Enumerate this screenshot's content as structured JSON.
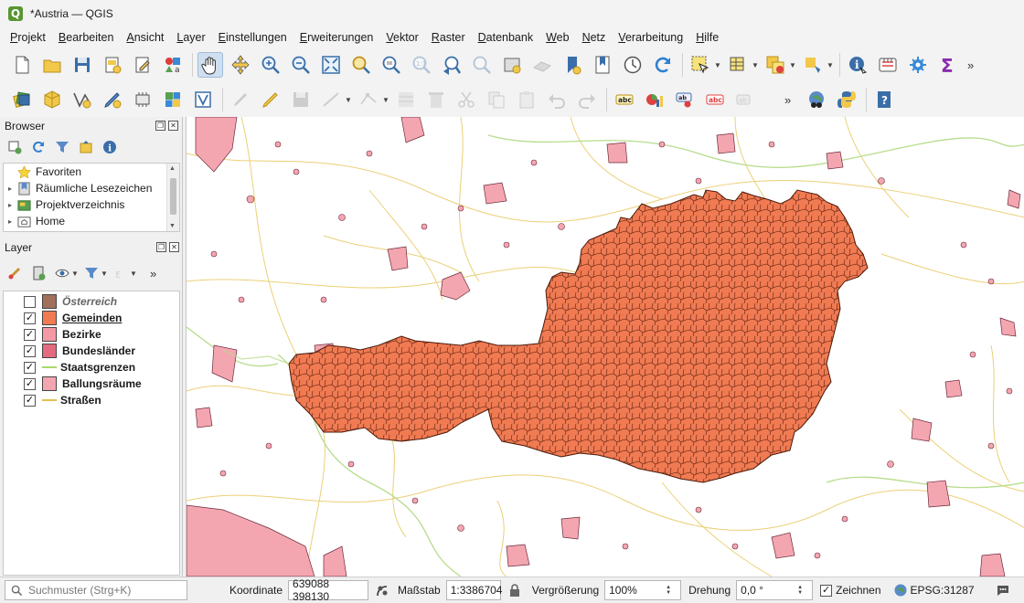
{
  "window": {
    "title": "*Austria — QGIS",
    "logo_letter": "Q"
  },
  "menu": [
    "Projekt",
    "Bearbeiten",
    "Ansicht",
    "Layer",
    "Einstellungen",
    "Erweiterungen",
    "Vektor",
    "Raster",
    "Datenbank",
    "Web",
    "Netz",
    "Verarbeitung",
    "Hilfe"
  ],
  "browser": {
    "title": "Browser",
    "items": [
      {
        "label": "Favoriten",
        "icon": "star-icon",
        "expand": ""
      },
      {
        "label": "Räumliche Lesezeichen",
        "icon": "bookmark-icon",
        "expand": "▸"
      },
      {
        "label": "Projektverzeichnis",
        "icon": "project-folder-icon",
        "expand": "▸"
      },
      {
        "label": "Home",
        "icon": "home-folder-icon",
        "expand": "▸"
      }
    ]
  },
  "layers": {
    "title": "Layer",
    "items": [
      {
        "label": "Österreich",
        "checked": false,
        "kind": "fill",
        "color": "#a0705a",
        "style": "italic"
      },
      {
        "label": "Gemeinden",
        "checked": true,
        "kind": "fill",
        "color": "#f07a52",
        "style": "underline"
      },
      {
        "label": "Bezirke",
        "checked": true,
        "kind": "fill",
        "color": "#f49aa6",
        "style": ""
      },
      {
        "label": "Bundesländer",
        "checked": true,
        "kind": "fill",
        "color": "#e46a80",
        "style": ""
      },
      {
        "label": "Staatsgrenzen",
        "checked": true,
        "kind": "line",
        "color": "#a6d96a",
        "style": ""
      },
      {
        "label": "Ballungsräume",
        "checked": true,
        "kind": "fill",
        "color": "#f4a6b0",
        "style": ""
      },
      {
        "label": "Straßen",
        "checked": true,
        "kind": "line",
        "color": "#e0c050",
        "style": ""
      }
    ]
  },
  "status": {
    "search_placeholder": "Suchmuster (Strg+K)",
    "coordinate_label": "Koordinate",
    "coordinate_value": "639088  398130",
    "scale_label": "Maßstab",
    "scale_value": "1:3386704",
    "magnifier_label": "Vergrößerung",
    "magnifier_value": "100%",
    "rotation_label": "Drehung",
    "rotation_value": "0,0 °",
    "render_label": "Zeichnen",
    "crs_label": "EPSG:31287"
  },
  "colors": {
    "municipality_fill": "#f07a52",
    "agglomeration_fill": "#f4a6b0",
    "road": "#e8c860",
    "border": "#b8dc8c"
  }
}
